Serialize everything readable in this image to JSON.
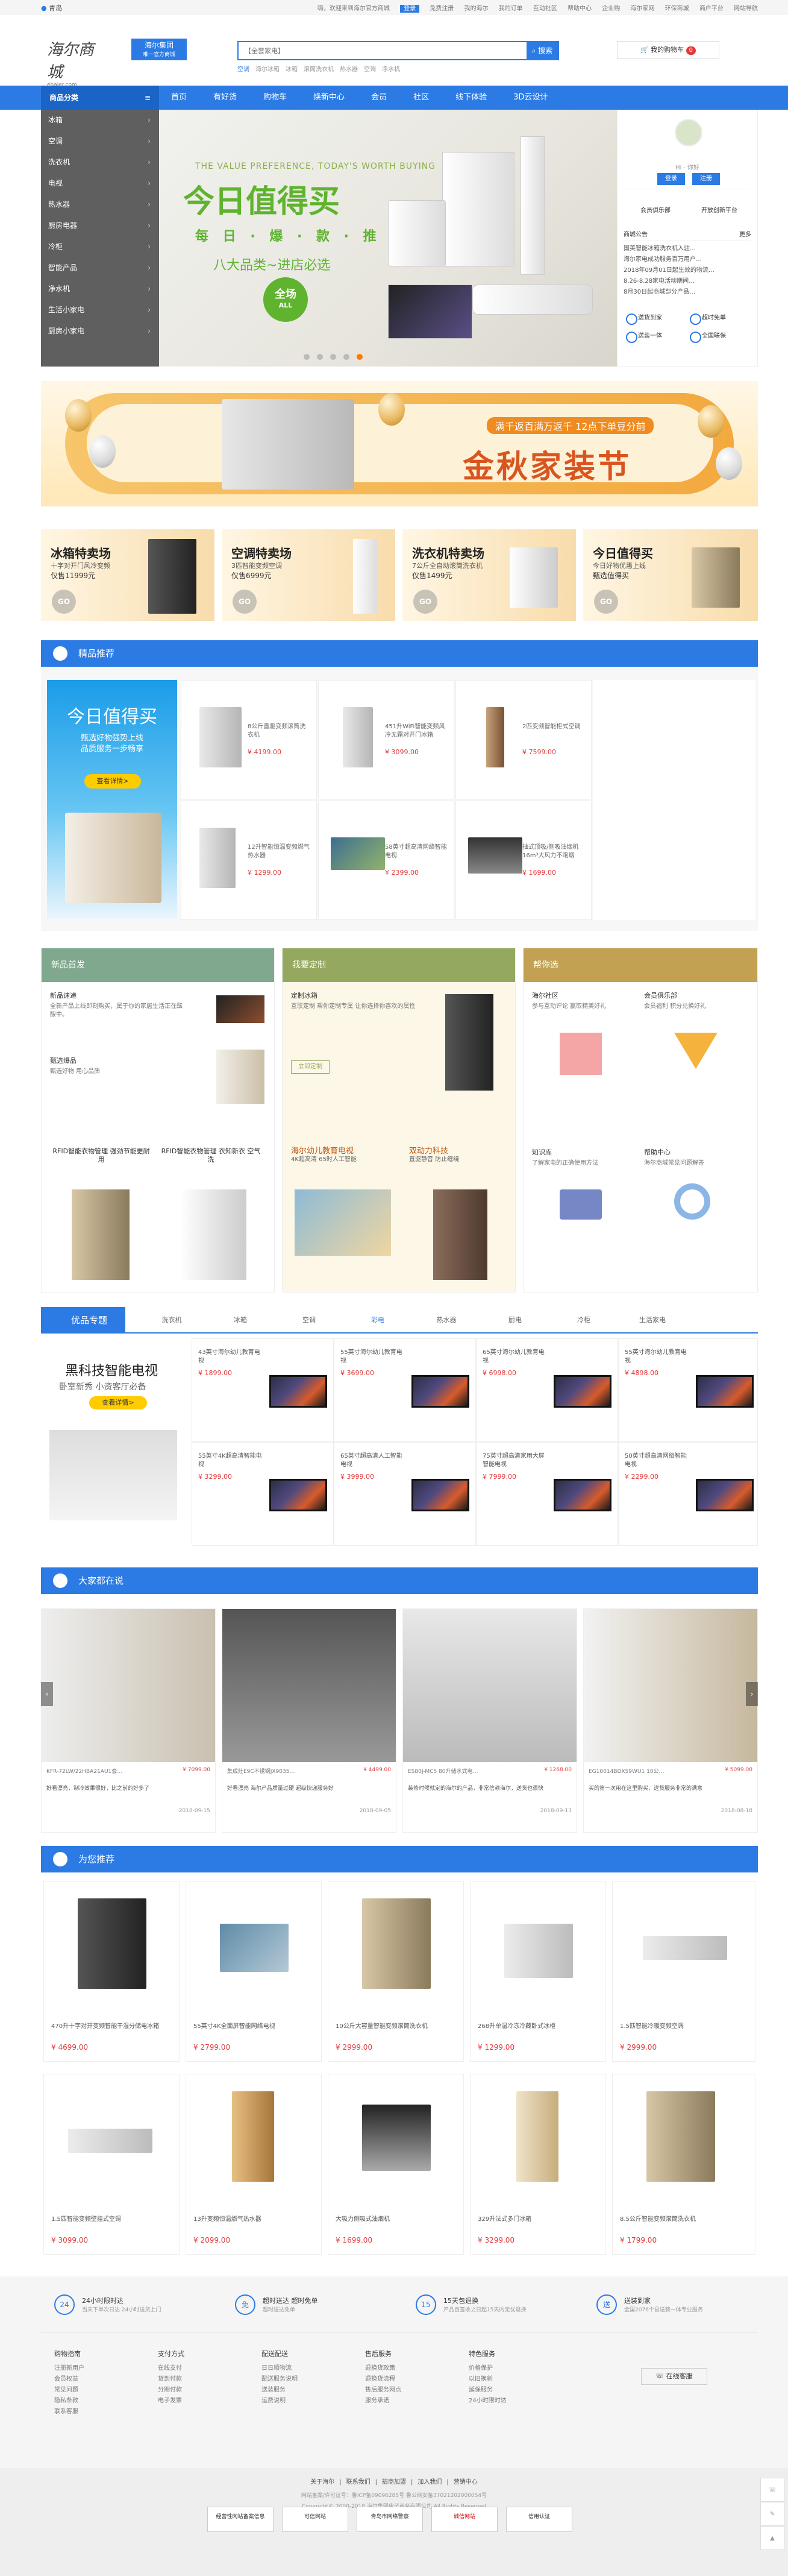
{
  "topbar": {
    "location": "青岛",
    "welcome": "嗨，欢迎来到海尔官方商城",
    "login": "登录",
    "links": [
      "免费注册",
      "我的海尔",
      "我的订单",
      "互动社区",
      "我的订单",
      "帮助中心",
      "企业购",
      "海尔家网",
      "环保商城",
      "商户平台",
      "网站导航"
    ]
  },
  "header": {
    "logo": "海尔商城",
    "logo_en": "ehaier.com",
    "badge_line1": "海尔集团",
    "badge_line2": "唯一官方商城",
    "search_placeholder": "【全套家电】",
    "search_btn": "搜索",
    "hot": [
      "空调",
      "海尔冰箱",
      "冰箱",
      "滚筒洗衣机",
      "热水器",
      "空调",
      "净水机"
    ],
    "cart": "我的购物车",
    "cart_count": "0"
  },
  "nav": {
    "category": "商品分类",
    "items": [
      "首页",
      "有好货",
      "智能家电",
      "新品",
      "购物车",
      "焕新中心",
      "会员",
      "社区",
      "线下体验",
      "3D云设计"
    ]
  },
  "sidemenu": [
    "冰箱",
    "空调",
    "洗衣机",
    "电视",
    "热水器",
    "厨房电器",
    "冷柜",
    "智能产品",
    "净水机",
    "生活小家电",
    "厨房小家电"
  ],
  "hero": {
    "en": "THE VALUE PREFERENCE, TODAY'S WORTH BUYING",
    "title": "今日值得买",
    "sub": "每 日 · 爆 · 款 · 推 · 荐",
    "line3": "八大品类~进店必选",
    "circle1": "全场",
    "circle2": "ALL"
  },
  "user": {
    "hi": "Hi · 你好",
    "login": "登录",
    "register": "注册",
    "member": "会员俱乐部",
    "finance": "开放创新平台",
    "news_title": "商城公告",
    "news_more": "更多",
    "news": [
      "国美智能冰箱洗衣机入驻…",
      "海尔家电成功服务百万用户…",
      "2018年09月01日起生效的物流…",
      "8.26-8.28家电活动期间…",
      "8月30日起商城部分产品…"
    ],
    "services": [
      "送货到家",
      "超时免单",
      "送装一体",
      "全国联保"
    ]
  },
  "banner": {
    "tag": "满千返百满万返千 12点下单豆分前",
    "title": "金秋家装节"
  },
  "promos": [
    {
      "title": "冰箱特卖场",
      "sub": "十字对开门风冷变频",
      "price": "仅售11999元",
      "go": "GO"
    },
    {
      "title": "空调特卖场",
      "sub": "3匹智能变频空调",
      "price": "仅售6999元",
      "go": "GO"
    },
    {
      "title": "洗衣机特卖场",
      "sub": "7公斤全自动滚筒洗衣机",
      "price": "仅售1499元",
      "go": "GO"
    },
    {
      "title": "今日值得买",
      "sub": "今日好物优惠上线",
      "price": "甄选值得买",
      "go": "GO"
    }
  ],
  "rec": {
    "header": "精品推荐",
    "left_title": "今日值得买",
    "left_sub1": "甄选好物强势上线",
    "left_sub2": "品质服务一步畅享",
    "left_btn": "查看详情>",
    "items": [
      {
        "name": "8公斤直驱变频滚筒洗衣机",
        "price": "¥ 4199.00"
      },
      {
        "name": "451升WiFi智能变频风冷无霜对开门冰箱",
        "price": "¥ 3099.00"
      },
      {
        "name": "2匹变频智能柜式空调",
        "price": "¥ 7599.00"
      },
      {
        "name": "12升智能恒温变频燃气热水器",
        "price": "¥ 1299.00"
      },
      {
        "name": "58英寸超高清网络智能电视",
        "price": "¥ 2399.00"
      },
      {
        "name": "抽式顶吸/侧吸油烟机 16m³大风力不跑烟",
        "price": "¥ 1699.00"
      }
    ]
  },
  "cols": {
    "new": {
      "header": "新品首发",
      "a_title": "新品速递",
      "a_desc": "全新产品上线即刻购买，属于你的家居生活正在酝酿中。",
      "b_title": "甄选爆品",
      "b_desc": "甄选好物 用心品质",
      "c": "RFID智能衣物管理 强劲节能更耐用",
      "d": "RFID智能衣物管理 衣知新衣 空气洗"
    },
    "custom": {
      "header": "我要定制",
      "a_title": "定制冰箱",
      "a_desc": "互联定制 帮你定制专属 让你选择你喜欢的属性",
      "btn": "立即定制",
      "b": "海尔幼儿教育电视",
      "b2": "4K超高清 65时人工智能",
      "c": "双动力科技",
      "c2": "直驱静音 防止缠绕"
    },
    "help": {
      "header": "帮你选",
      "a_title": "海尔社区",
      "a_desc": "参与互动评论 赢取精美好礼",
      "b_title": "会员俱乐部",
      "b_desc": "会员福利 积分兑换好礼",
      "c_title": "知识库",
      "c_desc": "了解家电的正确使用方法",
      "d_title": "帮助中心",
      "d_desc": "海尔商城常见问题解答"
    }
  },
  "yp": {
    "header": "优品专题",
    "tabs": [
      "洗衣机",
      "冰箱",
      "空调",
      "彩电",
      "热水器",
      "厨电",
      "冷柜",
      "生活家电"
    ],
    "left_title": "黑科技智能电视",
    "left_sub": "卧室新秀 小资客厅必备",
    "left_btn": "查看详情>",
    "items": [
      {
        "name": "43英寸海尔幼儿教育电视",
        "price": "¥ 1899.00"
      },
      {
        "name": "55英寸海尔幼儿教育电视",
        "price": "¥ 3699.00"
      },
      {
        "name": "65英寸海尔幼儿教育电视",
        "price": "¥ 6998.00"
      },
      {
        "name": "55英寸海尔幼儿教育电视",
        "price": "¥ 4898.00"
      },
      {
        "name": "55英寸4K超高清智能电视",
        "price": "¥ 3299.00"
      },
      {
        "name": "65英寸超高清人工智能电视",
        "price": "¥ 3999.00"
      },
      {
        "name": "75英寸超高清家用大屏智能电视",
        "price": "¥ 7999.00"
      },
      {
        "name": "50英寸超高清网络智能电视",
        "price": "¥ 2299.00"
      }
    ]
  },
  "say": {
    "header": "大家都在说",
    "items": [
      {
        "name": "KFR-72LW/22HBA21AU1套…",
        "price": "¥ 7099.00",
        "text": "好看漂亮，制冷效果很好，比之前的好多了",
        "date": "2018-09-15"
      },
      {
        "name": "集成灶E9C不锈钢JX9035…",
        "price": "¥ 4499.00",
        "text": "好看漂亮 海尔产品质量过硬 超级快递服务好",
        "date": "2018-09-05"
      },
      {
        "name": "ES80J-MC5 80升储水式电…",
        "price": "¥ 1268.00",
        "text": "装修时候就定的海尔的产品，非常信赖海尔，送货也很快",
        "date": "2018-09-13"
      },
      {
        "name": "EG10014BDX59WU1 10公…",
        "price": "¥ 5099.00",
        "text": "买的第一次用在这里购买，送货服务非常的满意",
        "date": "2018-08-18"
      }
    ]
  },
  "foryou": {
    "header": "为您推荐",
    "items": [
      {
        "name": "470升十字对开变频智能干湿分储电冰箱",
        "price": "¥ 4699.00"
      },
      {
        "name": "55英寸4K全面屏智能网络电视",
        "price": "¥ 2799.00"
      },
      {
        "name": "10公斤大容量智能变频滚筒洗衣机",
        "price": "¥ 2999.00"
      },
      {
        "name": "268升单温冷冻冷藏卧式冰柜",
        "price": "¥ 1299.00"
      },
      {
        "name": "1.5匹智能冷暖变频空调",
        "price": "¥ 2999.00"
      },
      {
        "name": "1.5匹智能变频壁挂式空调",
        "price": "¥ 3099.00"
      },
      {
        "name": "13升变频恒温燃气热水器",
        "price": "¥ 2099.00"
      },
      {
        "name": "大吸力侧吸式油烟机",
        "price": "¥ 1699.00"
      },
      {
        "name": "329升法式多门冰箱",
        "price": "¥ 3299.00"
      },
      {
        "name": "8.5公斤智能变频滚筒洗衣机",
        "price": "¥ 1799.00"
      }
    ]
  },
  "footer": {
    "guarantees": [
      {
        "icon": "24",
        "title": "24小时限时达",
        "sub": "当天下单次日达 24小时送货上门"
      },
      {
        "icon": "免",
        "title": "超时送达 超时免单",
        "sub": "超时送达免单"
      },
      {
        "icon": "15",
        "title": "15天包退换",
        "sub": "产品自签收之日起15天内无忧退换"
      },
      {
        "icon": "送",
        "title": "送装到家",
        "sub": "全国2076个县送装一体专业服务"
      }
    ],
    "cols": [
      {
        "h": "购物指南",
        "items": [
          "注册新用户",
          "会员权益",
          "常见问题",
          "隐私条款",
          "联系客服"
        ]
      },
      {
        "h": "支付方式",
        "items": [
          "在线支付",
          "货到付款",
          "分期付款",
          "电子发票"
        ]
      },
      {
        "h": "配送配送",
        "items": [
          "日日顺物流",
          "配送服务说明",
          "送装服务",
          "运费说明"
        ]
      },
      {
        "h": "售后服务",
        "items": [
          "退换货政策",
          "退换货流程",
          "售后服务网点",
          "服务承诺"
        ]
      },
      {
        "h": "特色服务",
        "items": [
          "价格保护",
          "以旧换新",
          "延保服务",
          "24小时限时达"
        ]
      }
    ],
    "service": "在线客服",
    "links": [
      "关于海尔",
      "联系我们",
      "招商加盟",
      "加入我们",
      "营销中心"
    ],
    "icp": "网站备案/许可证号：鲁ICP备09096285号  鲁公网安备37021202000054号",
    "copy": "Copyright© 2000-2018 海尔集团电子商务有限公司 All Rights Reserved",
    "certs": [
      "经营性网站备案信息",
      "可信网站",
      "青岛市网络警察",
      "诚信网站",
      "信用认证"
    ]
  }
}
